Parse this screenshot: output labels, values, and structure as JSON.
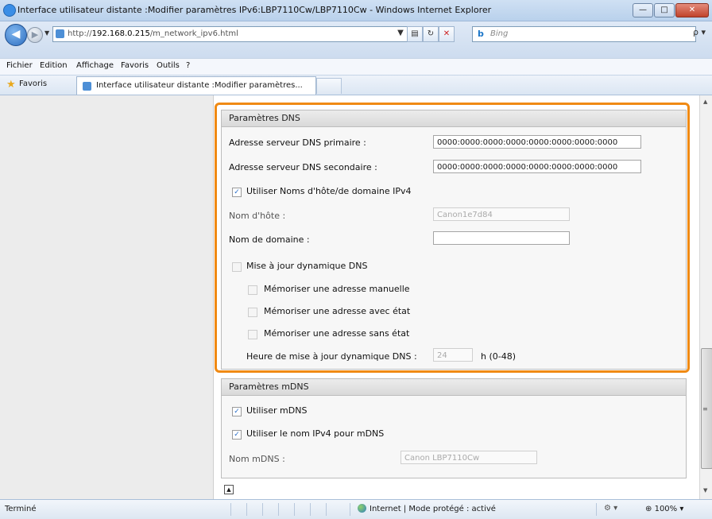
{
  "window": {
    "title": "Interface utilisateur distante :Modifier paramètres IPv6:LBP7110Cw/LBP7110Cw - Windows Internet Explorer",
    "minimize": "—",
    "maximize": "□",
    "close": "✕"
  },
  "address": {
    "url_prefix": "http://",
    "url_host": "192.168.0.215",
    "url_path": "/m_network_ipv6.html",
    "search_placeholder": "Bing",
    "search_logo": "b",
    "back": "◀",
    "forward": "▶",
    "dropdown": "▼",
    "compat": "▤",
    "refresh": "↻",
    "stop": "✕",
    "search_go": "ρ ▾"
  },
  "menu": [
    "Fichier",
    "Edition",
    "Affichage",
    "Favoris",
    "Outils",
    "?"
  ],
  "favorites": {
    "label": "Favoris",
    "star": "★",
    "tab_title": "Interface utilisateur distante :Modifier paramètres..."
  },
  "dns": {
    "header": "Paramètres DNS",
    "primary_label": "Adresse serveur DNS primaire :",
    "primary_value": "0000:0000:0000:0000:0000:0000:0000:0000",
    "secondary_label": "Adresse serveur DNS secondaire :",
    "secondary_value": "0000:0000:0000:0000:0000:0000:0000:0000",
    "use_ipv4_label": "Utiliser Noms d'hôte/de domaine IPv4",
    "host_label": "Nom d'hôte :",
    "host_value": "Canon1e7d84",
    "domain_label": "Nom de domaine :",
    "domain_value": "",
    "dyn_label": "Mise à jour dynamique DNS",
    "manual_label": "Mémoriser une adresse manuelle",
    "stateful_label": "Mémoriser une adresse avec état",
    "stateless_label": "Mémoriser une adresse sans état",
    "interval_label": "Heure de mise à jour dynamique DNS :",
    "interval_value": "24",
    "interval_unit": "h (0-48)",
    "check_mark": "✓"
  },
  "mdns": {
    "header": "Paramètres mDNS",
    "use_mdns_label": "Utiliser mDNS",
    "use_ipv4_name_label": "Utiliser le nom IPv4 pour mDNS",
    "name_label": "Nom mDNS :",
    "name_value": "Canon LBP7110Cw"
  },
  "page_top_icon": "▲",
  "scrollbar": {
    "up": "▲",
    "down": "▼",
    "grip": "≡"
  },
  "status": {
    "text": "Terminé",
    "zone": "Internet | Mode protégé : activé",
    "security": "⚙ ▾",
    "zoom": "100%",
    "zoom_prefix": "⊕",
    "zoom_suffix": "▾"
  }
}
